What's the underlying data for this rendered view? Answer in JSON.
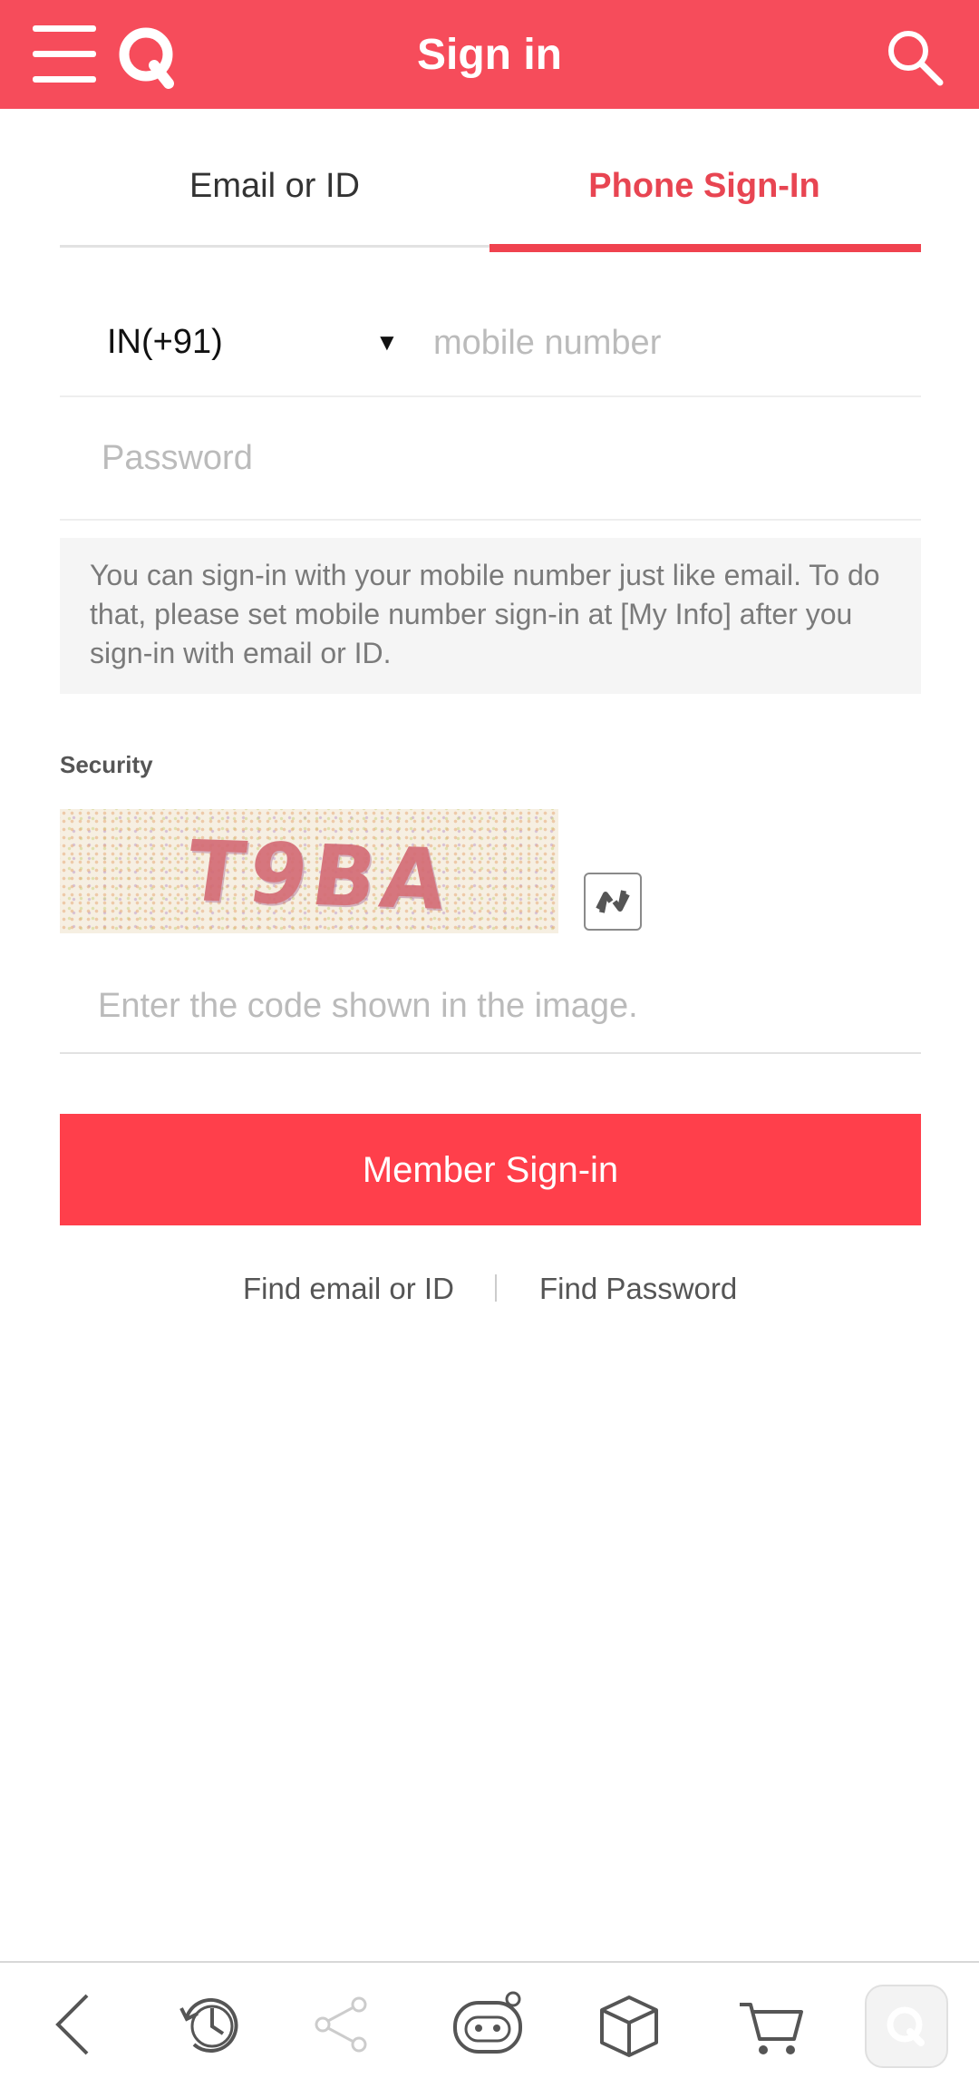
{
  "header": {
    "title": "Sign in",
    "brand_color": "#f64c5b",
    "icons": [
      "menu-icon",
      "qoo10-logo-icon",
      "search-icon"
    ]
  },
  "tabs": [
    {
      "label": "Email or ID",
      "active": false
    },
    {
      "label": "Phone Sign-In",
      "active": true
    }
  ],
  "form": {
    "country_code": "IN(+91)",
    "mobile_placeholder": "mobile number",
    "password_placeholder": "Password",
    "info_text": "You can sign-in with your mobile number just like email. To do that, please set mobile number sign-in at [My Info] after you sign-in with email or ID.",
    "security_label": "Security",
    "captcha_text": "T9BA",
    "code_placeholder": "Enter the code shown in the image.",
    "signin_label": "Member Sign-in",
    "button_color": "#ff3f4b"
  },
  "links": {
    "find_id": "Find email or ID",
    "find_password": "Find Password"
  },
  "bottom_bar": {
    "icons": [
      "back-icon",
      "history-icon",
      "share-icon",
      "qchat-robot-icon",
      "box-icon",
      "cart-icon",
      "qoo10-home-icon"
    ]
  }
}
